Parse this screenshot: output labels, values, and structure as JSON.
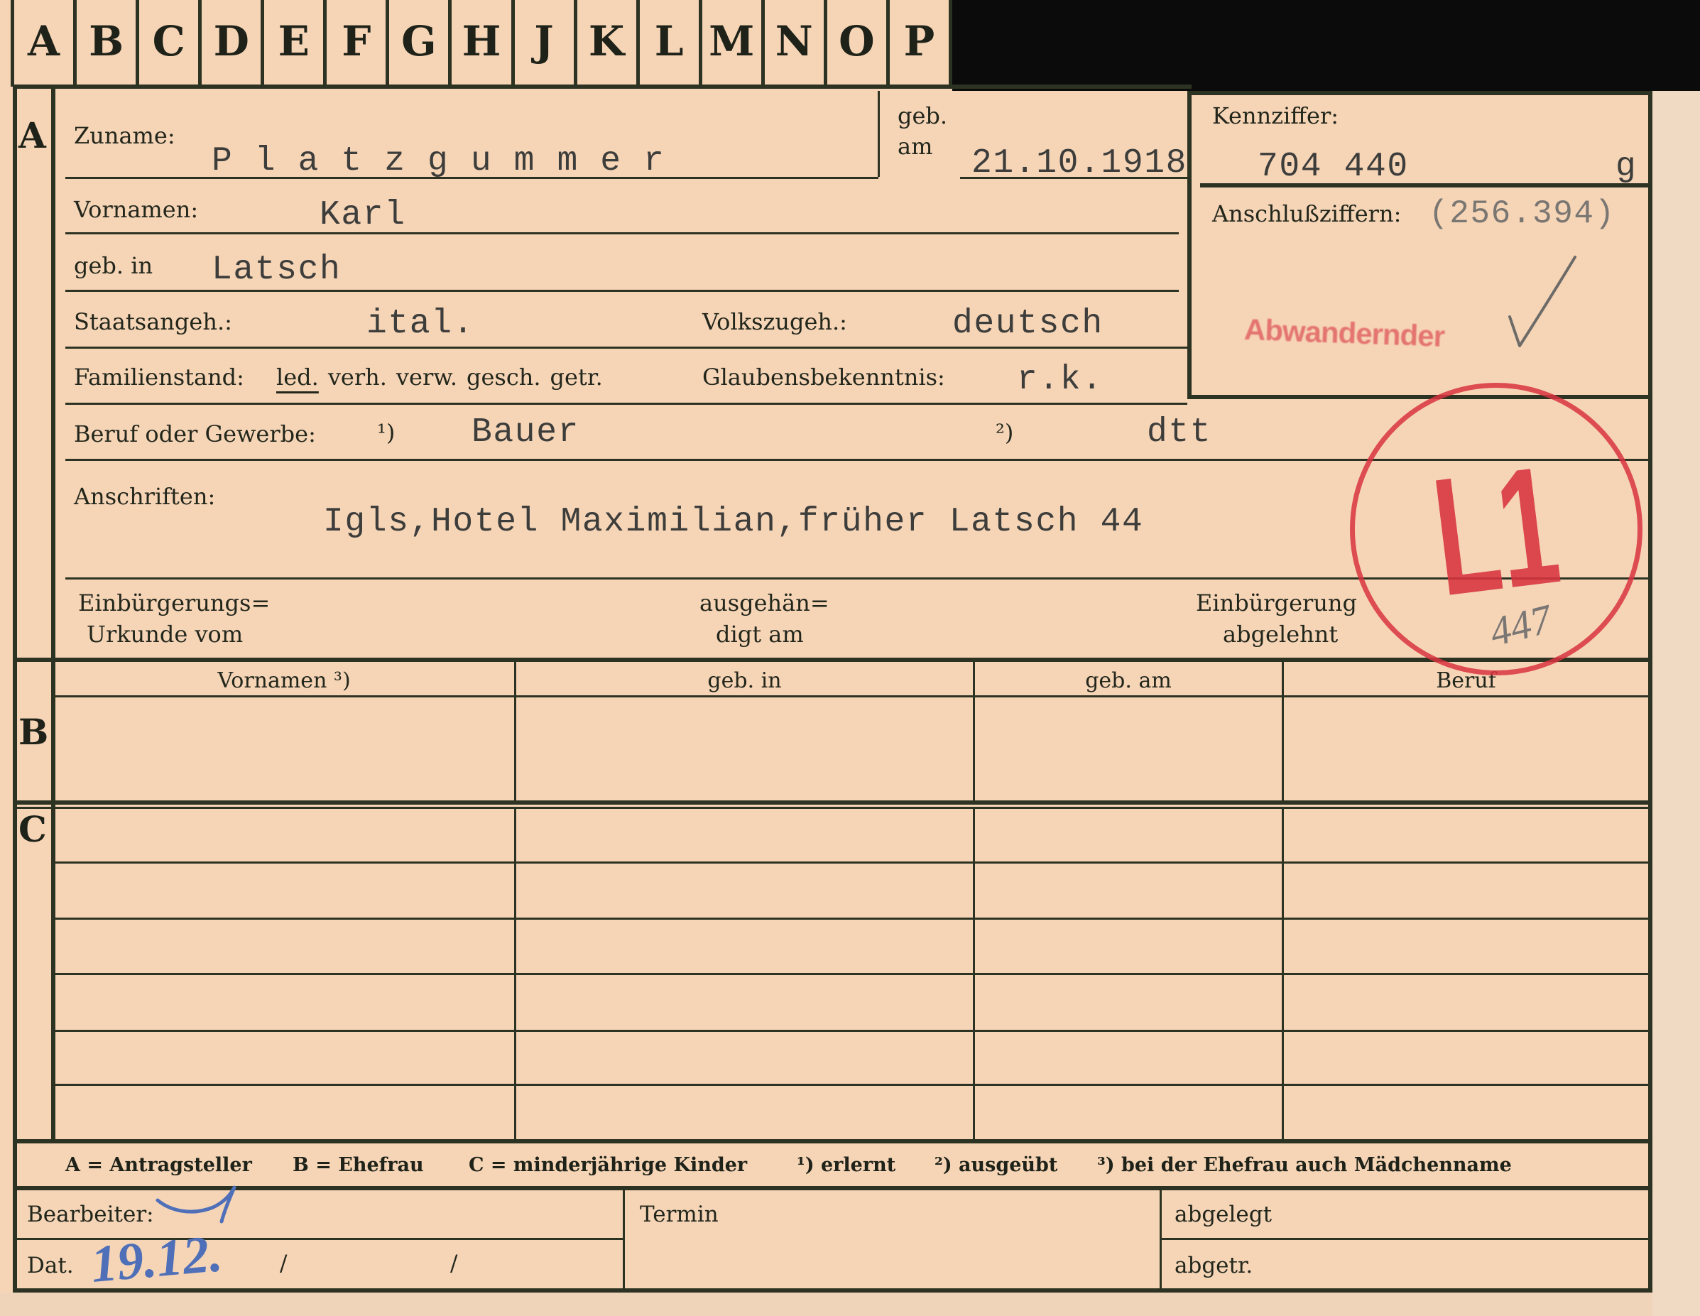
{
  "card": {
    "tabs": [
      "A",
      "B",
      "C",
      "D",
      "E",
      "F",
      "G",
      "H",
      "J",
      "K",
      "L",
      "M",
      "N",
      "O",
      "P"
    ],
    "section_letters": {
      "a": "A",
      "b": "B",
      "c": "C"
    },
    "applicant": {
      "surname_label": "Zuname:",
      "surname_value": "P l a t z g u m m e r",
      "birth_date_label": [
        "geb.",
        "am"
      ],
      "birth_date_value": "21.10.1918",
      "first_names_label": "Vornamen:",
      "first_names_value": "Karl",
      "birthplace_label": "geb. in",
      "birthplace_value": "Latsch",
      "citizenship_label": "Staatsangeh.:",
      "citizenship_value": "ital.",
      "ethnicity_label": "Volkszugeh.:",
      "ethnicity_value": "deutsch",
      "marital_status_label": "Familienstand:",
      "marital_status_options": [
        "led.",
        "verh.",
        "verw.",
        "gesch.",
        "getr."
      ],
      "marital_status_selected_index": 0,
      "religion_label": "Glaubensbekenntnis:",
      "religion_value": "r.k.",
      "occupation_label": "Beruf oder Gewerbe:",
      "occupation_learned_marker": "¹)",
      "occupation_learned_value": "Bauer",
      "occupation_practiced_marker": "²)",
      "occupation_practiced_value": "dtt",
      "address_label": "Anschriften:",
      "address_value": "Igls,Hotel Maximilian,früher Latsch 44",
      "naturalization_certificate_label": [
        "Einbürgerungs=",
        "Urkunde vom"
      ],
      "handed_over_label": [
        "ausgehän=",
        "digt am"
      ],
      "naturalization_refused_label": [
        "Einbürgerung",
        "abgelehnt"
      ]
    },
    "id_box": {
      "id_label": "Kennziffer:",
      "id_value": "704 440",
      "id_suffix": "g",
      "related_ids_label": "Anschlußziffern:",
      "related_ids_value": "(256.394)",
      "faded_stamp_text": "Abwandernder"
    },
    "stamp": {
      "text": "L1",
      "handwritten_number": "447"
    },
    "spouse_table": {
      "headers": [
        "Vornamen ³)",
        "geb. in",
        "geb. am",
        "Beruf"
      ]
    },
    "legend": [
      "A = Antragsteller",
      "B = Ehefrau",
      "C = minderjährige Kinder",
      "¹) erlernt",
      "²) ausgeübt",
      "³) bei der Ehefrau auch Mädchenname"
    ],
    "footer": {
      "processor_label": "Bearbeiter:",
      "date_label": "Dat.",
      "date_handwritten": "19.12.",
      "date_separators": [
        "/",
        "/"
      ],
      "deadline_label": "Termin",
      "filed_label": "abgelegt",
      "removed_label": "abgetr."
    },
    "colors": {
      "card": "#f6d5b7",
      "rules": "#2d3322",
      "stamp_red": "#d8343f",
      "handwriting_blue": "#4f6fb8",
      "backdrop": "#0b0b0b"
    }
  }
}
